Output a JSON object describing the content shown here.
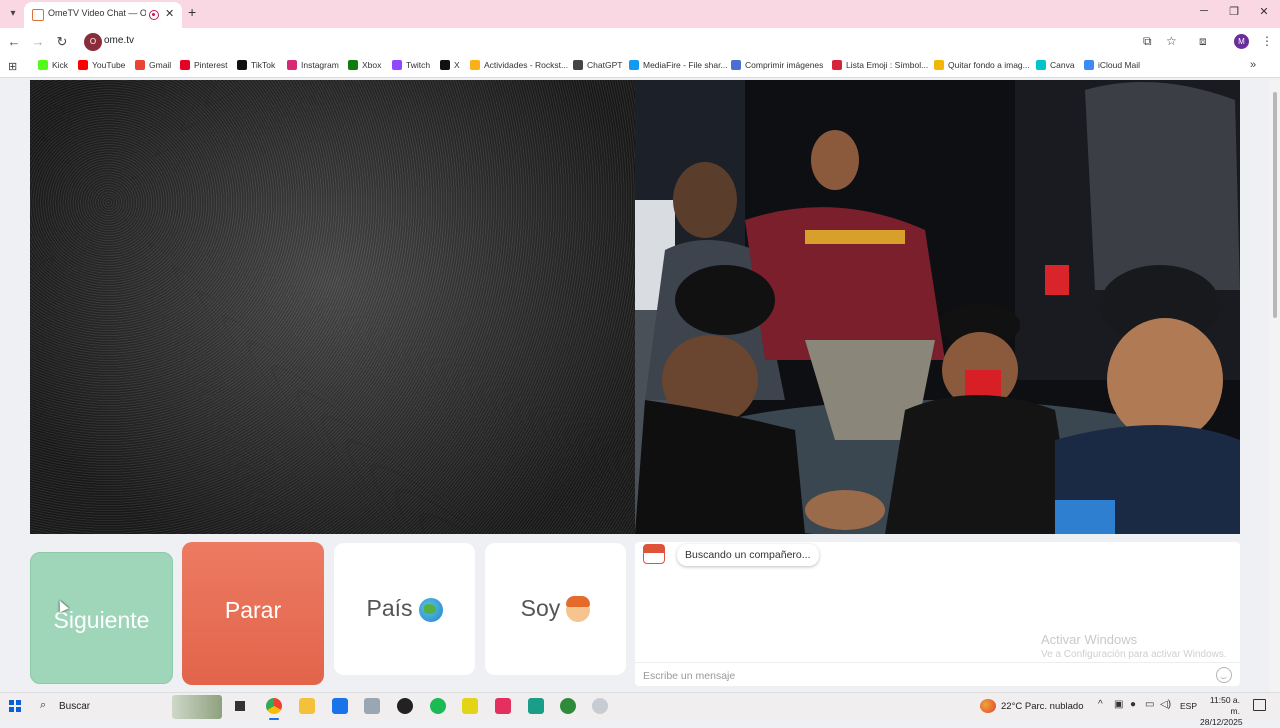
{
  "browser": {
    "tab_title": "OmeTV Video Chat — Ome",
    "url": "ome.tv",
    "site_icon_text": "O",
    "profile_initial": "M",
    "bookmarks": [
      {
        "label": "Kick",
        "color": "#53fc18"
      },
      {
        "label": "YouTube",
        "color": "#ff0000"
      },
      {
        "label": "Gmail",
        "color": "#ea4335"
      },
      {
        "label": "Pinterest",
        "color": "#e60023"
      },
      {
        "label": "TikTok",
        "color": "#111111"
      },
      {
        "label": "Instagram",
        "color": "#d62976"
      },
      {
        "label": "Xbox",
        "color": "#107c10"
      },
      {
        "label": "Twitch",
        "color": "#9146ff"
      },
      {
        "label": "X",
        "color": "#111111"
      },
      {
        "label": "Actividades - Rockst...",
        "color": "#fcaf17"
      },
      {
        "label": "ChatGPT",
        "color": "#444444"
      },
      {
        "label": "MediaFire - File shar...",
        "color": "#1299f3"
      },
      {
        "label": "Comprimir imágenes",
        "color": "#4a6fd1"
      },
      {
        "label": "Lista Emoji : Símbol...",
        "color": "#d7223b"
      },
      {
        "label": "Quitar fondo a imag...",
        "color": "#f2b705"
      },
      {
        "label": "Canva",
        "color": "#00c4cc"
      },
      {
        "label": "iCloud Mail",
        "color": "#3d8af7"
      }
    ]
  },
  "omegle": {
    "next_label": "Siguiente",
    "stop_label": "Parar",
    "country_label": "País",
    "gender_label": "Soy",
    "chat_logo_text": "Ome TV",
    "status_message": "Buscando un compañero...",
    "message_placeholder": "Escribe un mensaje",
    "watermark_title": "Activar Windows",
    "watermark_sub": "Ve a Configuración para activar Windows."
  },
  "taskbar": {
    "search_label": "Buscar",
    "weather": "22°C  Parc. nublado",
    "language": "ESP",
    "time": "11:50 a. m.",
    "date": "28/12/2025"
  },
  "colors": {
    "next": "#9fd5b8",
    "stop": "#e6694f",
    "tab_strip": "#f9d7e3"
  }
}
